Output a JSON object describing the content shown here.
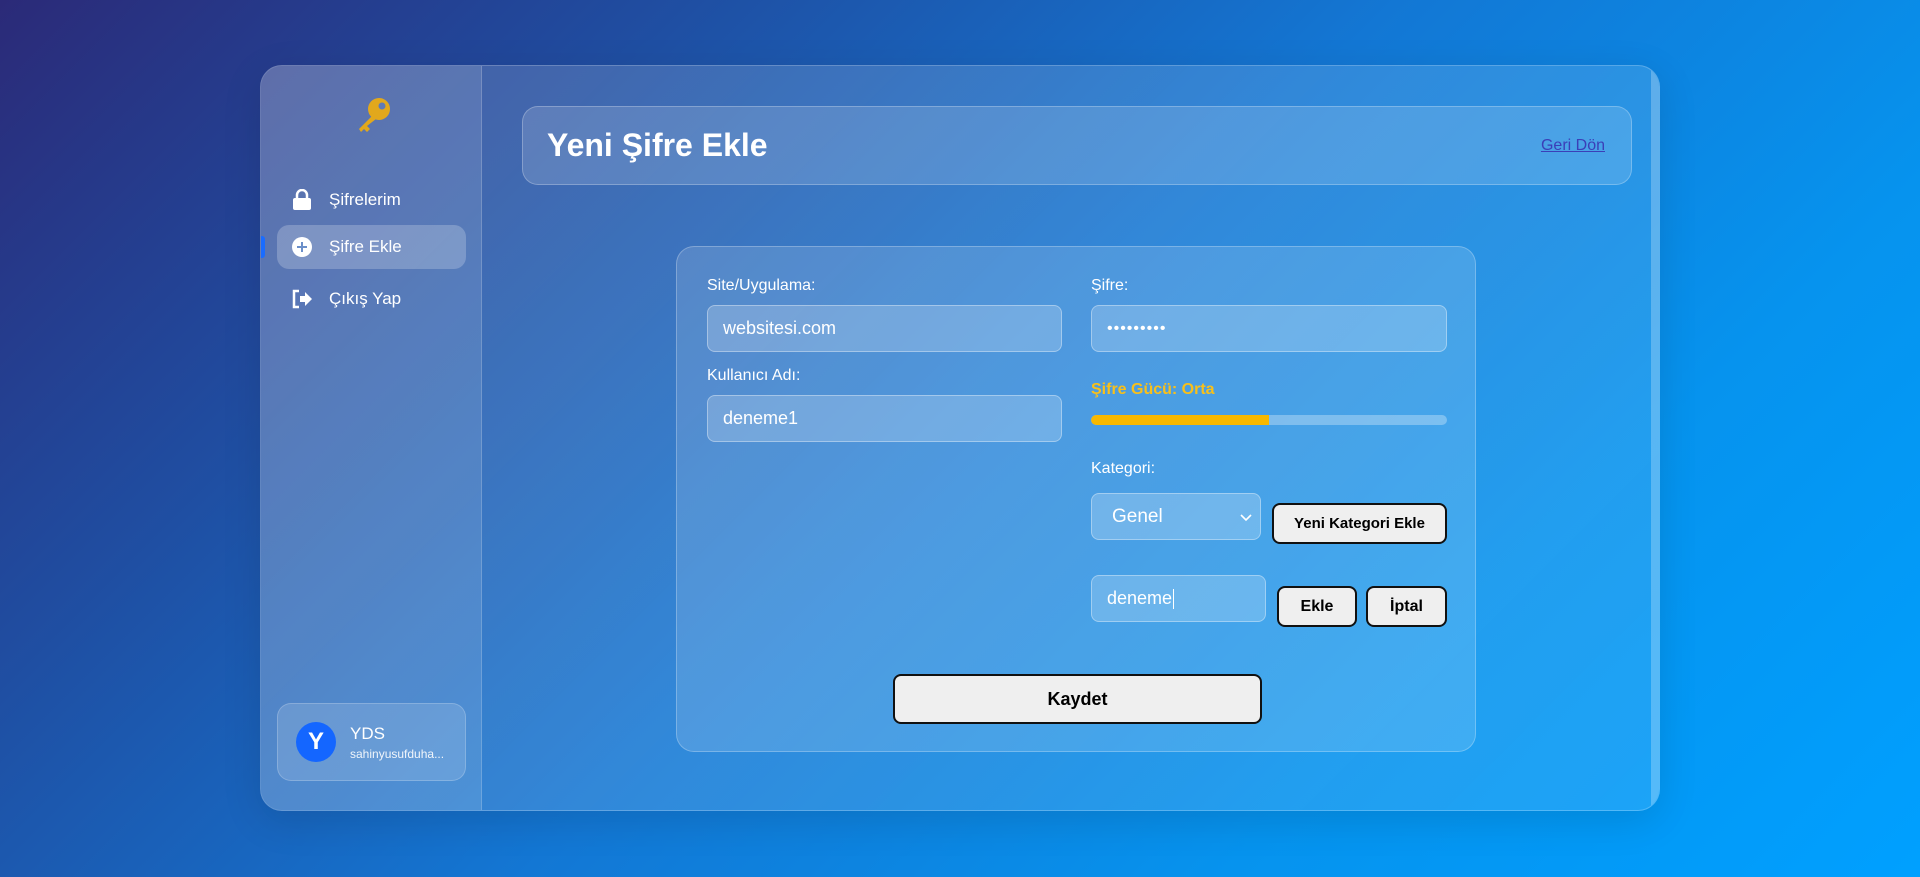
{
  "sidebar": {
    "logo_icon": "key-icon",
    "items": [
      {
        "label": "Şifrelerim",
        "icon": "lock-icon",
        "active": false
      },
      {
        "label": "Şifre Ekle",
        "icon": "plus-circle-icon",
        "active": true
      },
      {
        "label": "Çıkış Yap",
        "icon": "logout-icon",
        "active": false
      }
    ],
    "user": {
      "initial": "Y",
      "name": "YDS",
      "email": "sahinyusufduha..."
    }
  },
  "header": {
    "title": "Yeni Şifre Ekle",
    "back_link": "Geri Dön"
  },
  "form": {
    "site_label": "Site/Uygulama:",
    "site_value": "websitesi.com",
    "username_label": "Kullanıcı Adı:",
    "username_value": "deneme1",
    "password_label": "Şifre:",
    "password_value": "•••••••••",
    "strength_label": "Şifre Gücü: Orta",
    "strength_fraction": 0.5,
    "category_label": "Kategori:",
    "category_selected": "Genel",
    "add_category_button": "Yeni Kategori Ekle",
    "new_category_value": "deneme",
    "add_button": "Ekle",
    "cancel_button": "İptal",
    "save_button": "Kaydet"
  },
  "colors": {
    "accent": "#1466ff",
    "strength": "#f8b800",
    "link": "#3b3fb8"
  }
}
